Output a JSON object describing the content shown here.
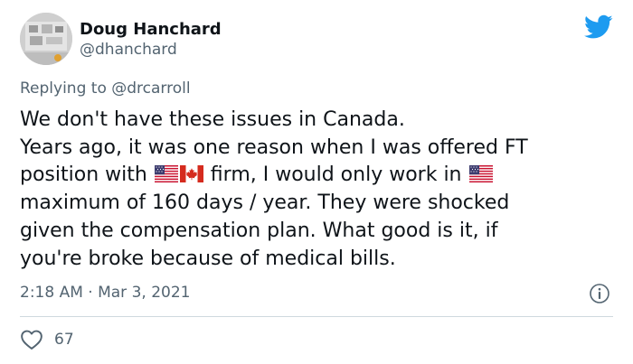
{
  "author": {
    "display_name": "Doug Hanchard",
    "handle": "@dhanchard"
  },
  "reply": {
    "prefix": "Replying to ",
    "mention": "@drcarroll"
  },
  "body": {
    "line1": "We don't have these issues in Canada.",
    "line2": "Years ago, it was one reason when I was offered FT",
    "line3_before_flags": "position with ",
    "line3_after_flags": " firm, I would only work in ",
    "line4": " maximum of 160 days / year. They were shocked",
    "line5": "given the compensation plan. What good is it, if",
    "line6": "you're broke because of medical bills."
  },
  "meta": {
    "timestamp": "2:18 AM · Mar 3, 2021"
  },
  "actions": {
    "like_count": "67"
  },
  "icons": {
    "brand": "twitter-bird-icon",
    "info": "info-icon",
    "like": "heart-icon",
    "flags": [
      "us-flag-icon",
      "canada-flag-icon",
      "us-flag-icon"
    ]
  },
  "colors": {
    "brand_blue": "#1d9bf0",
    "text_primary": "#0f1419",
    "text_secondary": "#536471",
    "divider": "#cfd9de"
  }
}
